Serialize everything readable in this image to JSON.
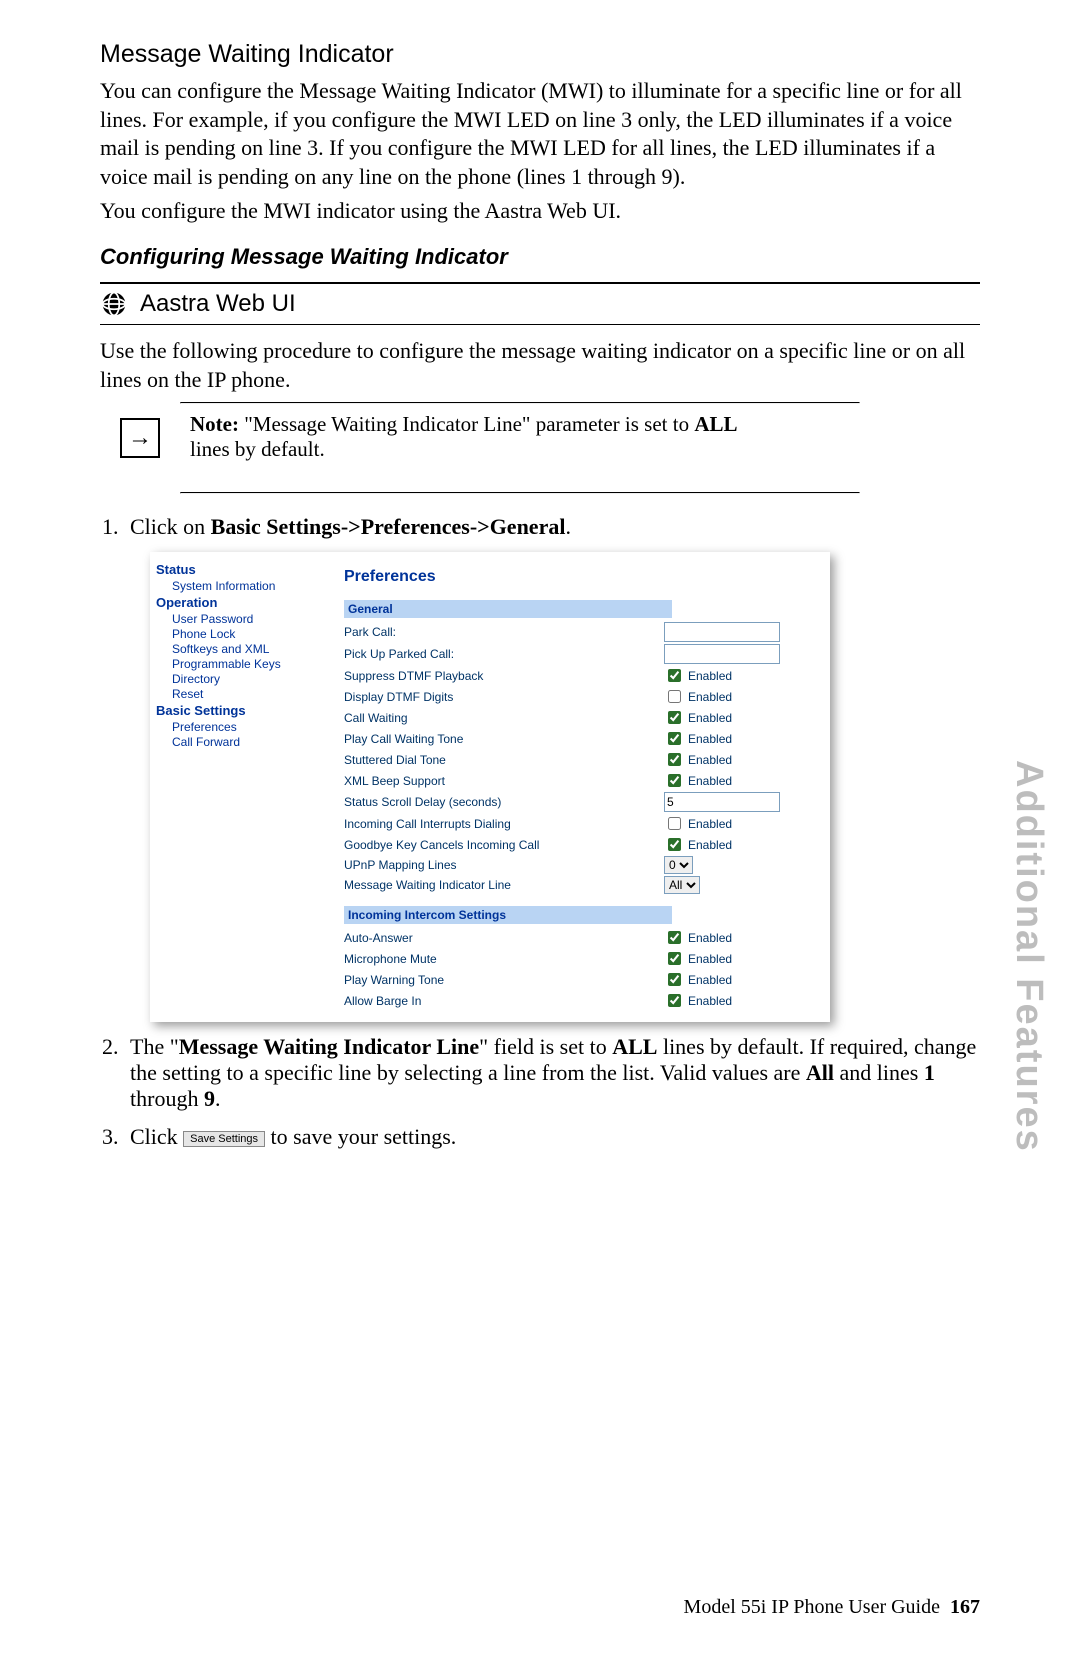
{
  "heading": "Message Waiting Indicator",
  "para1": "You can configure the Message Waiting Indicator (MWI) to illuminate for a specific line or for all lines. For example, if you configure the MWI LED on line 3 only, the LED illuminates if a voice mail is pending on line 3. If you configure the MWI LED for all lines, the LED illuminates if a voice mail is pending on any line on the phone (lines 1 through 9).",
  "para2": "You configure the MWI indicator using the Aastra Web UI.",
  "subheading": "Configuring Message Waiting Indicator",
  "aastra_label": "Aastra Web UI",
  "intro": "Use the following procedure to configure the message waiting indicator on a specific line or on all lines on the IP phone.",
  "note_label": "Note:",
  "note_text": " \"Message Waiting Indicator Line\" parameter is set to ",
  "note_bold": "ALL",
  "note_tail": " lines by default.",
  "step1_prefix": "Click on ",
  "step1_bold": "Basic Settings->Preferences->General",
  "step1_suffix": ".",
  "ui": {
    "sidebar": {
      "status": "Status",
      "sysinfo": "System Information",
      "operation": "Operation",
      "userpw": "User Password",
      "phonelock": "Phone Lock",
      "softkeys": "Softkeys and XML",
      "progkeys": "Programmable Keys",
      "directory": "Directory",
      "reset": "Reset",
      "basic": "Basic Settings",
      "prefs": "Preferences",
      "callfwd": "Call Forward"
    },
    "title": "Preferences",
    "general": "General",
    "rows": {
      "park": "Park Call:",
      "pickup": "Pick Up Parked Call:",
      "dtmf_pb": "Suppress DTMF Playback",
      "dtmf_dg": "Display DTMF Digits",
      "cw": "Call Waiting",
      "cwtone": "Play Call Waiting Tone",
      "stutter": "Stuttered Dial Tone",
      "xmlbeep": "XML Beep Support",
      "scroll": "Status Scroll Delay (seconds)",
      "scroll_val": "5",
      "incoming_int": "Incoming Call Interrupts Dialing",
      "goodbye": "Goodbye Key Cancels Incoming Call",
      "upnp": "UPnP Mapping Lines",
      "upnp_val": "0",
      "mwi": "Message Waiting Indicator Line",
      "mwi_val": "All",
      "enabled": "Enabled"
    },
    "intercom_section": "Incoming Intercom Settings",
    "intercom": {
      "auto": "Auto-Answer",
      "mic": "Microphone Mute",
      "warn": "Play Warning Tone",
      "barge": "Allow Barge In"
    }
  },
  "step2_a": "The \"",
  "step2_b": "Message Waiting Indicator Line",
  "step2_c": "\" field is set to ",
  "step2_d": "ALL",
  "step2_e": " lines by default. If required, change the setting to a specific line by selecting a line from the list. Valid values are ",
  "step2_f": "All",
  "step2_g": " and lines ",
  "step2_h": "1",
  "step2_i": " through ",
  "step2_j": "9",
  "step2_k": ".",
  "step3_a": "Click ",
  "save_button": "Save Settings",
  "step3_b": " to save your settings.",
  "sidetab": "Additional Features",
  "footer_text": "Model 55i IP Phone User Guide",
  "footer_page": "167"
}
